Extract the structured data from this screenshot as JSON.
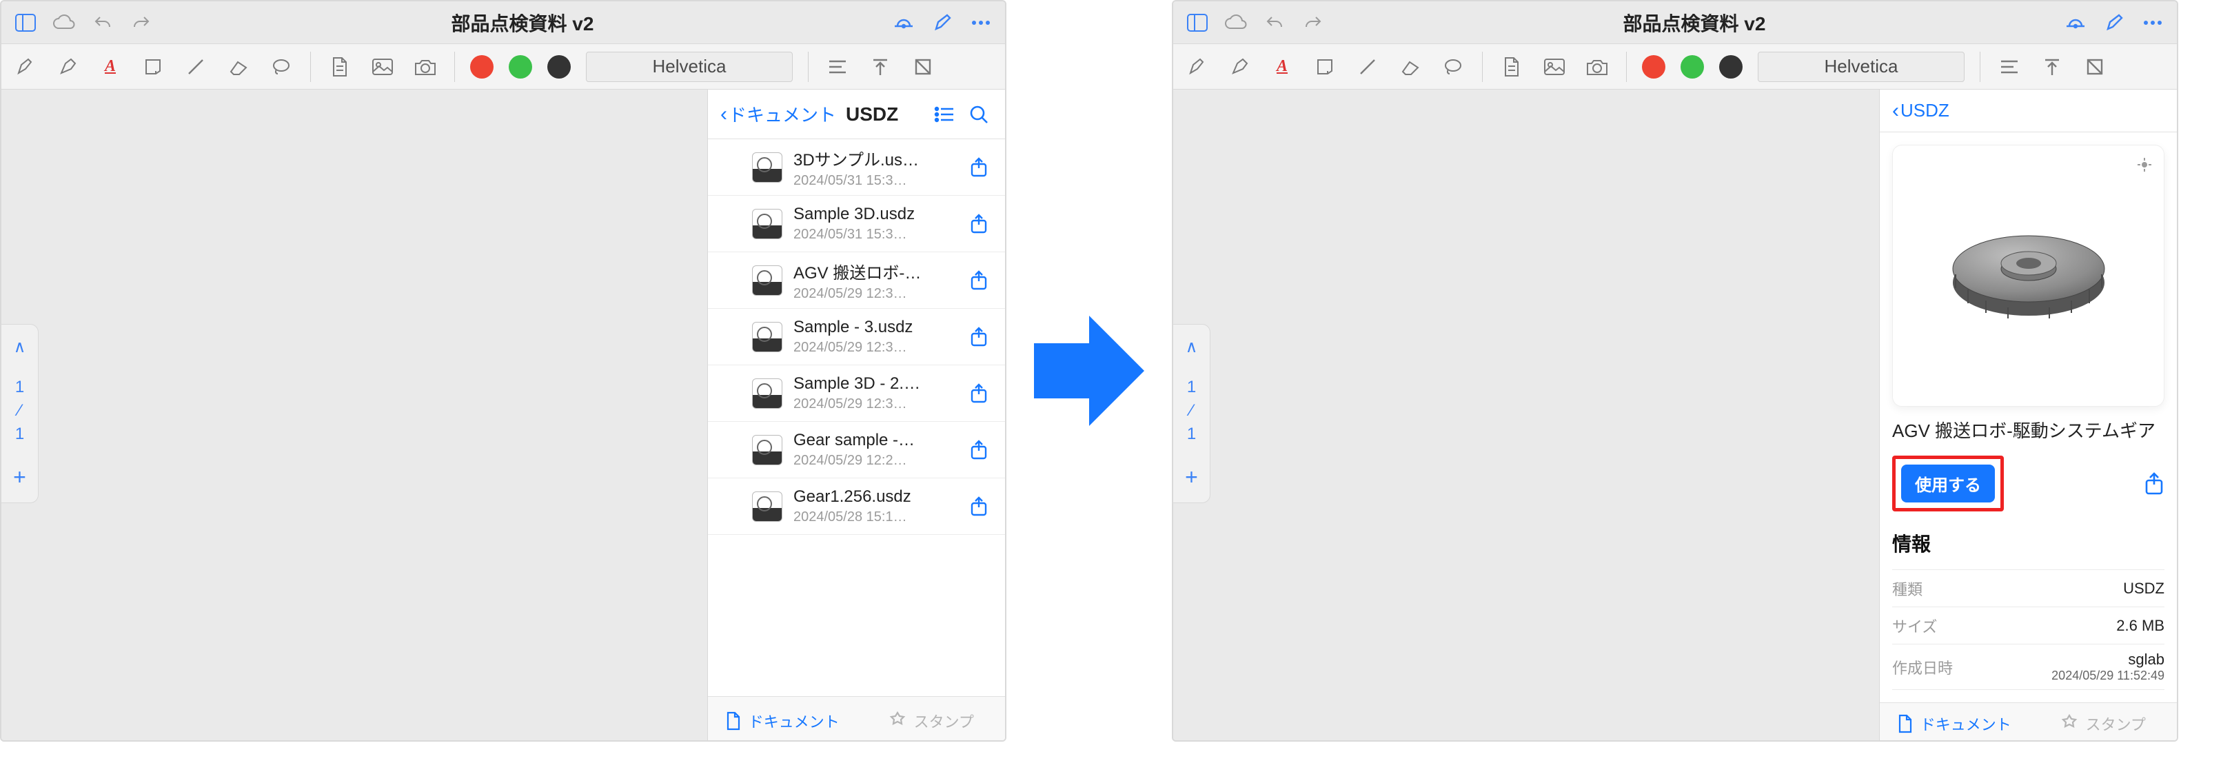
{
  "window_title": "部品点検資料 v2",
  "font_name": "Helvetica",
  "text_tool_label": "A",
  "pager": {
    "current": "1",
    "total": "1",
    "chevron": "∧",
    "plus": "+"
  },
  "list_panel": {
    "back_label": "ドキュメント",
    "title": "USDZ",
    "footer": {
      "doc": "ドキュメント",
      "stamp": "スタンプ"
    },
    "items": [
      {
        "name": "3Dサンプル.us…",
        "date": "2024/05/31 15:3…"
      },
      {
        "name": "Sample 3D.usdz",
        "date": "2024/05/31 15:3…"
      },
      {
        "name": "AGV 搬送ロボ-…",
        "date": "2024/05/29 12:3…"
      },
      {
        "name": "Sample - 3.usdz",
        "date": "2024/05/29 12:3…"
      },
      {
        "name": "Sample 3D - 2.…",
        "date": "2024/05/29 12:3…"
      },
      {
        "name": "Gear sample -…",
        "date": "2024/05/29 12:2…"
      },
      {
        "name": "Gear1.256.usdz",
        "date": "2024/05/28 15:1…"
      }
    ]
  },
  "detail_panel": {
    "back_label": "USDZ",
    "title_line": "AGV 搬送ロボ-駆動システムギア",
    "use_label": "使用する",
    "info_heading": "情報",
    "kv": [
      {
        "k": "種類",
        "v": "USDZ"
      },
      {
        "k": "サイズ",
        "v": "2.6 MB"
      },
      {
        "k": "作成日時",
        "v": "sglab",
        "sub": "2024/05/29 11:52:49"
      }
    ],
    "footer": {
      "doc": "ドキュメント",
      "stamp": "スタンプ"
    }
  },
  "colors": {
    "accent_blue": "#1677ff",
    "highlight_red": "#e22222"
  }
}
